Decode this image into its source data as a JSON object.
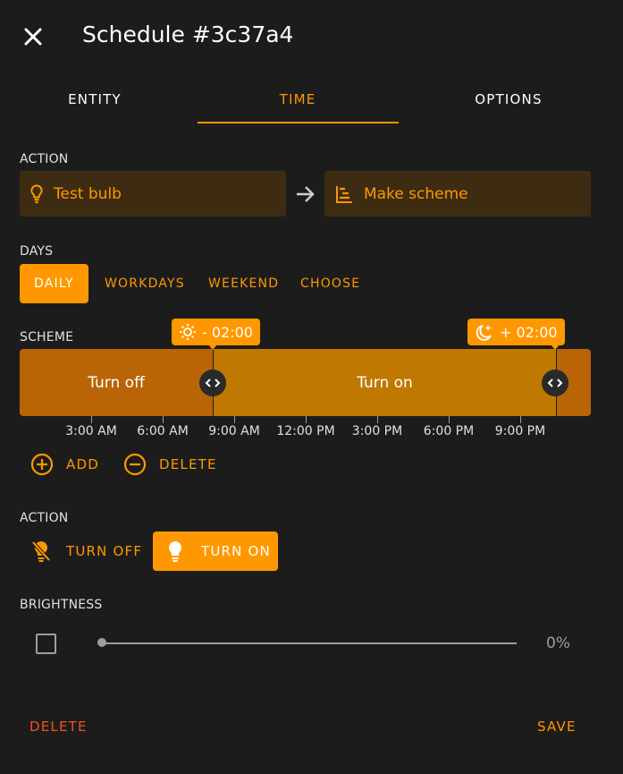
{
  "dialog": {
    "title": "Schedule #3c37a4"
  },
  "tabs": [
    "ENTITY",
    "TIME",
    "OPTIONS"
  ],
  "action_section": {
    "label": "ACTION",
    "entity": "Test bulb",
    "service": "Make scheme"
  },
  "days": {
    "label": "DAYS",
    "options": [
      "DAILY",
      "WORKDAYS",
      "WEEKEND",
      "CHOOSE"
    ],
    "selected": "DAILY"
  },
  "scheme": {
    "label": "SCHEME",
    "segments": [
      "Turn off",
      "Turn on"
    ],
    "markers": [
      {
        "icon": "sunrise-icon",
        "text": "- 02:00"
      },
      {
        "icon": "sunset-icon",
        "text": "+ 02:00"
      }
    ],
    "axis_labels": [
      "3:00 AM",
      "6:00 AM",
      "9:00 AM",
      "12:00 PM",
      "3:00 PM",
      "6:00 PM",
      "9:00 PM"
    ]
  },
  "scheme_actions": {
    "add": "ADD",
    "delete": "DELETE"
  },
  "slot_action": {
    "label": "ACTION",
    "turn_off": "TURN OFF",
    "turn_on": "TURN ON",
    "selected": "TURN ON"
  },
  "brightness": {
    "label": "BRIGHTNESS",
    "value_text": "0%",
    "value_fraction": 0
  },
  "footer": {
    "delete": "DELETE",
    "save": "SAVE"
  },
  "colors": {
    "accent": "#ff9800",
    "background": "#1c1c1c",
    "segment_off": "#b86407",
    "segment_on": "#bf7800",
    "danger": "#f4511e"
  }
}
